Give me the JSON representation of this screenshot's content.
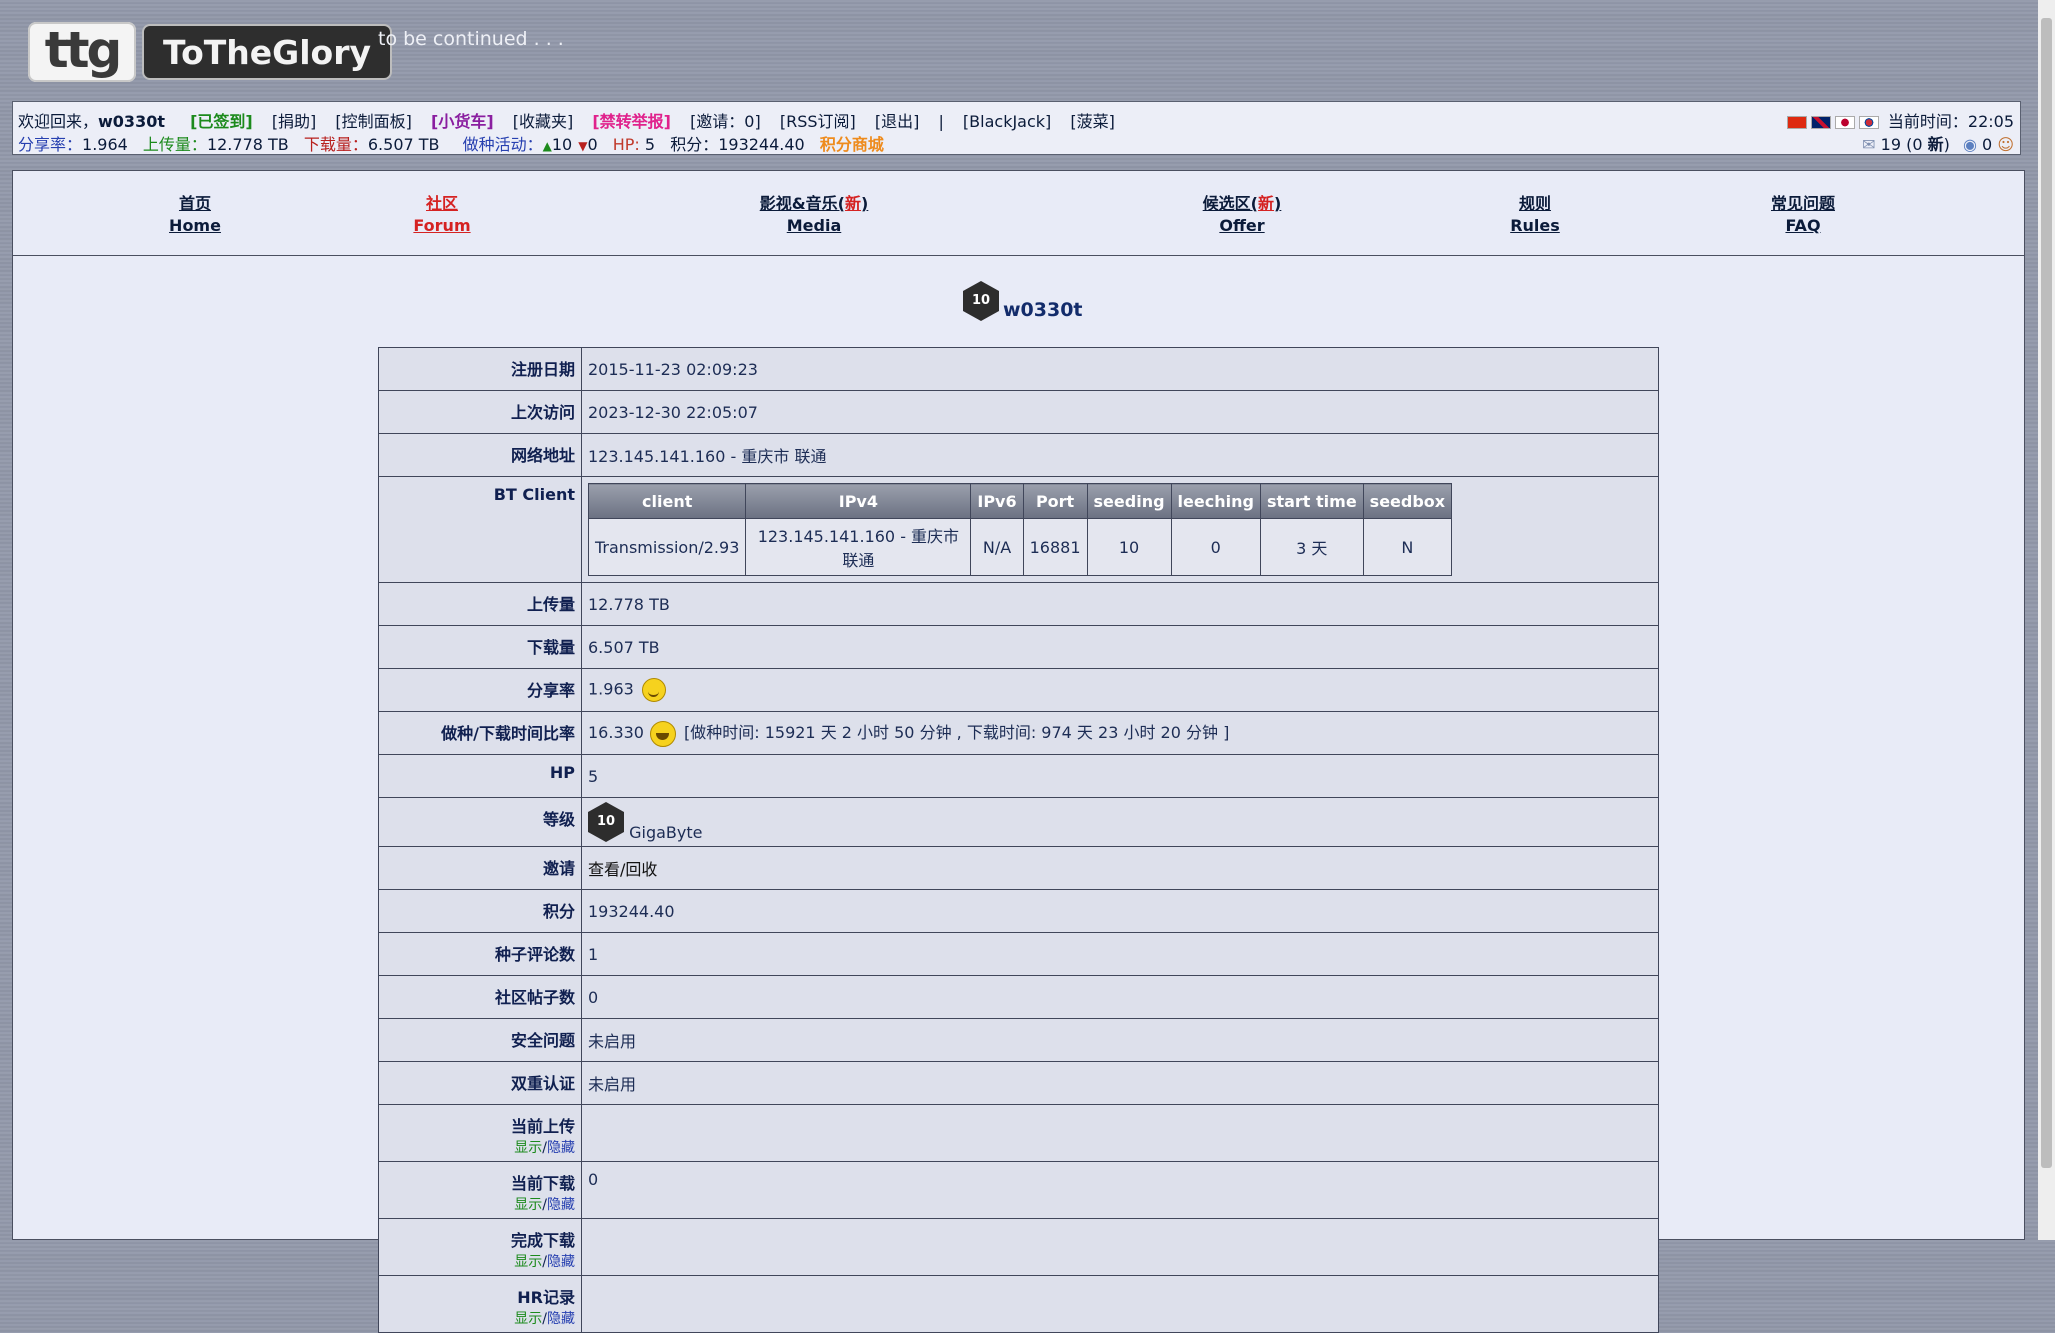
{
  "logo": {
    "short": "ttg",
    "name": "ToTheGlory"
  },
  "slogan": "to be continued . . .",
  "userbar": {
    "welcome": "欢迎回来，",
    "username": "w0330t",
    "links": [
      "[已签到]",
      "[捐助]",
      "[控制面板]",
      "[小货车]",
      "[收藏夹]",
      "[禁转举报]",
      "[邀请：0]",
      "[RSS订阅]",
      "[退出]",
      "|",
      "[BlackJack]",
      "[菠菜]"
    ],
    "ratio_label": "分享率：",
    "ratio": "1.964",
    "upload_label": "上传量：",
    "upload": "12.778 TB",
    "download_label": "下载量：",
    "download": "6.507 TB",
    "activity_label": "做种活动：",
    "seeding": "10",
    "leeching": "0",
    "hp_label": "HP:",
    "hp": "5",
    "points_label": "积分：",
    "points": "193244.40",
    "shop": "积分商城",
    "time_label": "当前时间：",
    "time": "22:05",
    "messages": "19 (0 ",
    "messages_new": "新",
    "messages_end": ")",
    "friends": "0",
    "flags": [
      "flag-cn",
      "flag-gb",
      "flag-jp",
      "flag-kr"
    ]
  },
  "nav": [
    {
      "cn": "首页",
      "en": "Home"
    },
    {
      "cn": "社区",
      "en": "Forum"
    },
    {
      "cn": "影视&音乐(",
      "new": "新",
      "close": ")",
      "en": "Media"
    },
    {
      "cn": "候选区(",
      "new": "新",
      "close": ")",
      "en": "Offer"
    },
    {
      "cn": "规则",
      "en": "Rules"
    },
    {
      "cn": "常见问题",
      "en": "FAQ"
    }
  ],
  "profile": {
    "badge": "10",
    "username": "w0330t",
    "rows": {
      "reg_label": "注册日期",
      "reg": "2015-11-23 02:09:23",
      "last_label": "上次访问",
      "last": "2023-12-30 22:05:07",
      "ip_label": "网络地址",
      "ip": "123.145.141.160 - 重庆市 联通",
      "bt_label": "BT Client",
      "up_label": "上传量",
      "up": "12.778 TB",
      "down_label": "下载量",
      "down": "6.507 TB",
      "ratio_label": "分享率",
      "ratio": "1.963",
      "seedratio_label": "做种/下载时间比率",
      "seedratio": "16.330",
      "seedratio_detail": "[做种时间: 15921 天 2 小时 50 分钟 , 下载时间: 974 天 23 小时 20 分钟 ]",
      "hp_label": "HP",
      "hp": "5",
      "level_label": "等级",
      "level": "GigaByte",
      "invite_label": "邀请",
      "invite": "查看/回收",
      "points_label": "积分",
      "points": "193244.40",
      "comments_label": "种子评论数",
      "comments": "1",
      "posts_label": "社区帖子数",
      "posts": "0",
      "security_label": "安全问题",
      "security": "未启用",
      "twofa_label": "双重认证",
      "twofa": "未启用",
      "cur_up_label": "当前上传",
      "cur_up": "",
      "cur_down_label": "当前下载",
      "cur_down": "0",
      "done_label": "完成下载",
      "done": "",
      "hr_label": "HR记录",
      "hr": "",
      "toggle_show": "显示",
      "toggle_sep": "/",
      "toggle_hide": "隐藏"
    },
    "bt_headers": [
      "client",
      "IPv4",
      "IPv6",
      "Port",
      "seeding",
      "leeching",
      "start time",
      "seedbox"
    ],
    "bt_row": [
      "Transmission/2.93",
      "123.145.141.160 - 重庆市 联通",
      "N/A",
      "16881",
      "10",
      "0",
      "3 天",
      "N"
    ]
  }
}
